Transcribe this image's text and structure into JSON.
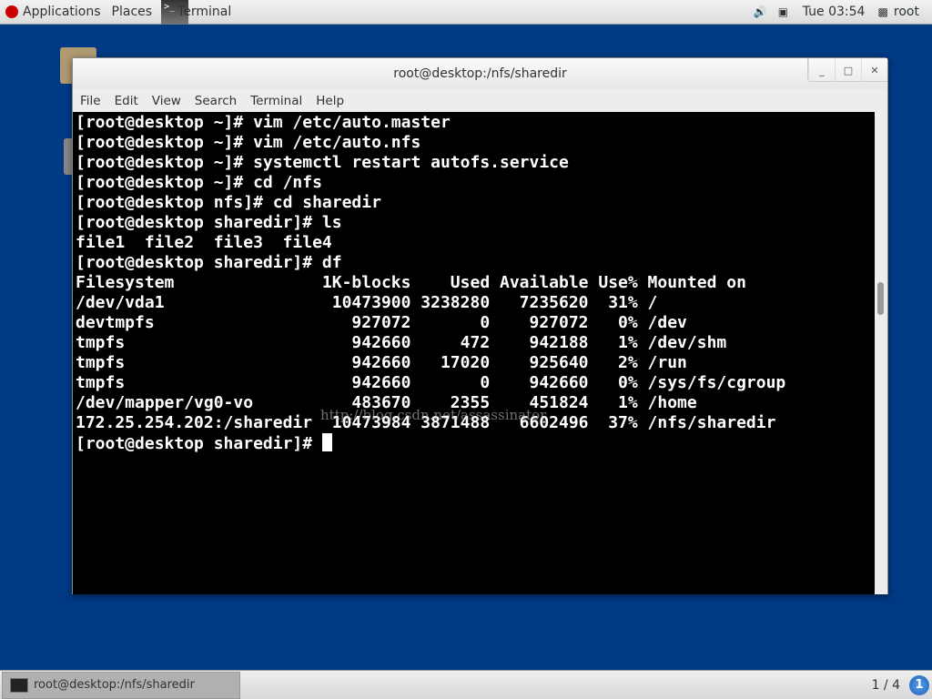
{
  "topbar": {
    "applications": "Applications",
    "places": "Places",
    "terminal": "Terminal",
    "clock": "Tue 03:54",
    "user": "root"
  },
  "window": {
    "title": "root@desktop:/nfs/sharedir",
    "menu": [
      "File",
      "Edit",
      "View",
      "Search",
      "Terminal",
      "Help"
    ]
  },
  "terminal": {
    "lines": [
      "[root@desktop ~]# vim /etc/auto.master",
      "[root@desktop ~]# vim /etc/auto.nfs",
      "[root@desktop ~]# systemctl restart autofs.service",
      "[root@desktop ~]# cd /nfs",
      "[root@desktop nfs]# cd sharedir",
      "[root@desktop sharedir]# ls",
      "file1  file2  file3  file4",
      "[root@desktop sharedir]# df",
      "Filesystem               1K-blocks    Used Available Use% Mounted on",
      "/dev/vda1                 10473900 3238280   7235620  31% /",
      "devtmpfs                    927072       0    927072   0% /dev",
      "tmpfs                       942660     472    942188   1% /dev/shm",
      "tmpfs                       942660   17020    925640   2% /run",
      "tmpfs                       942660       0    942660   0% /sys/fs/cgroup",
      "/dev/mapper/vg0-vo          483670    2355    451824   1% /home",
      "172.25.254.202:/sharedir  10473984 3871488   6602496  37% /nfs/sharedir"
    ],
    "prompt": "[root@desktop sharedir]# ",
    "watermark": "http://blog.csdn.net/assassinator"
  },
  "taskbar": {
    "task": "root@desktop:/nfs/sharedir",
    "workspace": "1 / 4",
    "workspace_num": "1"
  }
}
